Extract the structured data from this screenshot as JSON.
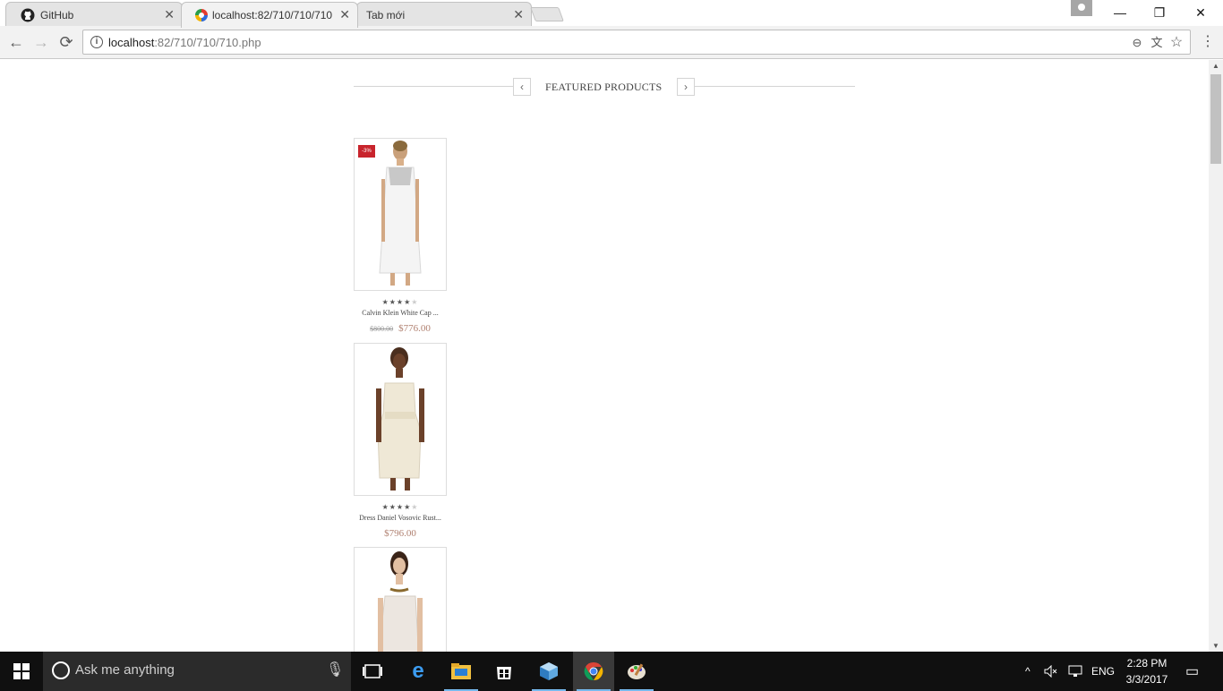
{
  "browser": {
    "tabs": [
      {
        "title": "GitHub",
        "icon": "github-icon",
        "active": false
      },
      {
        "title": "localhost:82/710/710/710",
        "icon": "site-favicon-icon",
        "active": true
      },
      {
        "title": "Tab mới",
        "icon": "",
        "active": false
      }
    ],
    "close_glyph": "✕",
    "window_controls": {
      "minimize": "—",
      "restore": "❐",
      "close": "✕"
    },
    "address": {
      "host": "localhost",
      "path": ":82/710/710/710.php"
    },
    "nav": {
      "back": "←",
      "forward": "→",
      "reload": "⟳"
    },
    "omni_icons": {
      "zoom": "⊖",
      "translate": "文",
      "star": "☆"
    },
    "menu_glyph": "⋮"
  },
  "page": {
    "section_title": "FEATURED PRODUCTS",
    "prev_arrow": "‹",
    "next_arrow": "›",
    "products": [
      {
        "name": "Calvin Klein White Cap ...",
        "old_price": "$800.00",
        "price": "$776.00",
        "badge": "-3%",
        "rating": 4,
        "max_rating": 5,
        "dress_color": "#f4f4f4"
      },
      {
        "name": "Dress Daniel Vosovic Rust...",
        "old_price": "",
        "price": "$796.00",
        "badge": "",
        "rating": 4,
        "max_rating": 5,
        "dress_color": "#efe8d6"
      },
      {
        "name": "",
        "old_price": "",
        "price": "",
        "badge": "",
        "rating": 0,
        "max_rating": 5,
        "dress_color": "#ece6e0"
      }
    ]
  },
  "taskbar": {
    "search_placeholder": "Ask me anything",
    "language": "ENG",
    "time": "2:28 PM",
    "date": "3/3/2017",
    "tray_up": "^",
    "notification_glyph": "▭"
  },
  "colors": {
    "sale_badge": "#c8242c",
    "price": "#b08070",
    "taskbar": "#101010"
  }
}
